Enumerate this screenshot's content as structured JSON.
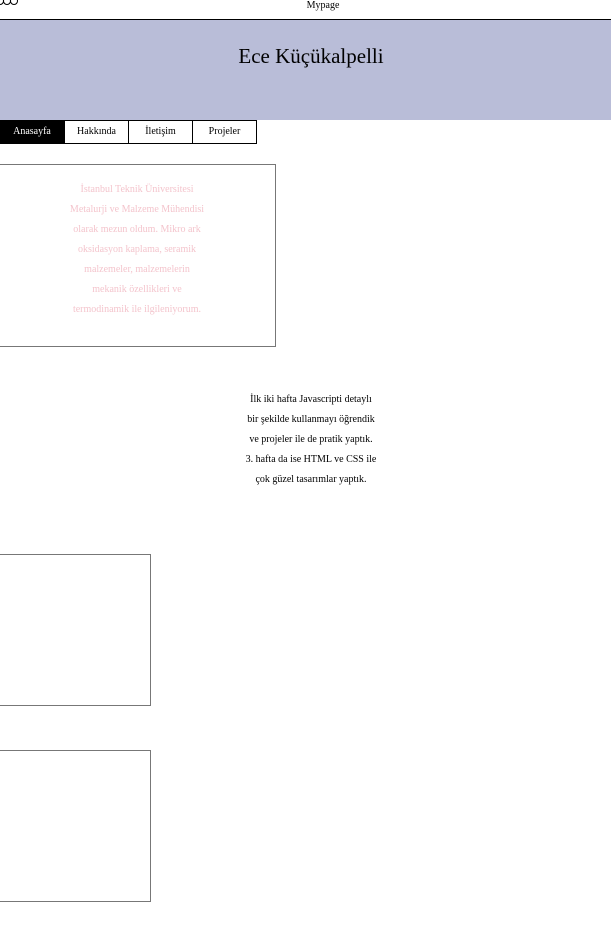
{
  "topbar": {
    "title": "Mypage",
    "logo_icon": "three-circles-logo-icon"
  },
  "header": {
    "name": "Ece Küçükalpelli",
    "background": "#b9bdd8"
  },
  "nav": {
    "tabs": [
      {
        "label": "Anasayfa",
        "active": true
      },
      {
        "label": "Hakkında",
        "active": false
      },
      {
        "label": "İletişim",
        "active": false
      },
      {
        "label": "Projeler",
        "active": false
      }
    ]
  },
  "about": {
    "text": "İstanbul Teknik Üniversitesi Metalurji ve Malzeme Mühendisi olarak mezun oldum. Mikro ark oksidasyon kaplama, seramik malzemeler, malzemelerin mekanik özellikleri ve termodinamik ile ilgileniyorum.",
    "text_color": "#f4c5cd"
  },
  "main": {
    "text": "İlk iki hafta Javascripti detaylı bir şekilde kullanmayı öğrendik ve projeler ile de pratik yaptık. 3. hafta da ise HTML ve CSS ile çok güzel tasarımlar yaptık."
  }
}
